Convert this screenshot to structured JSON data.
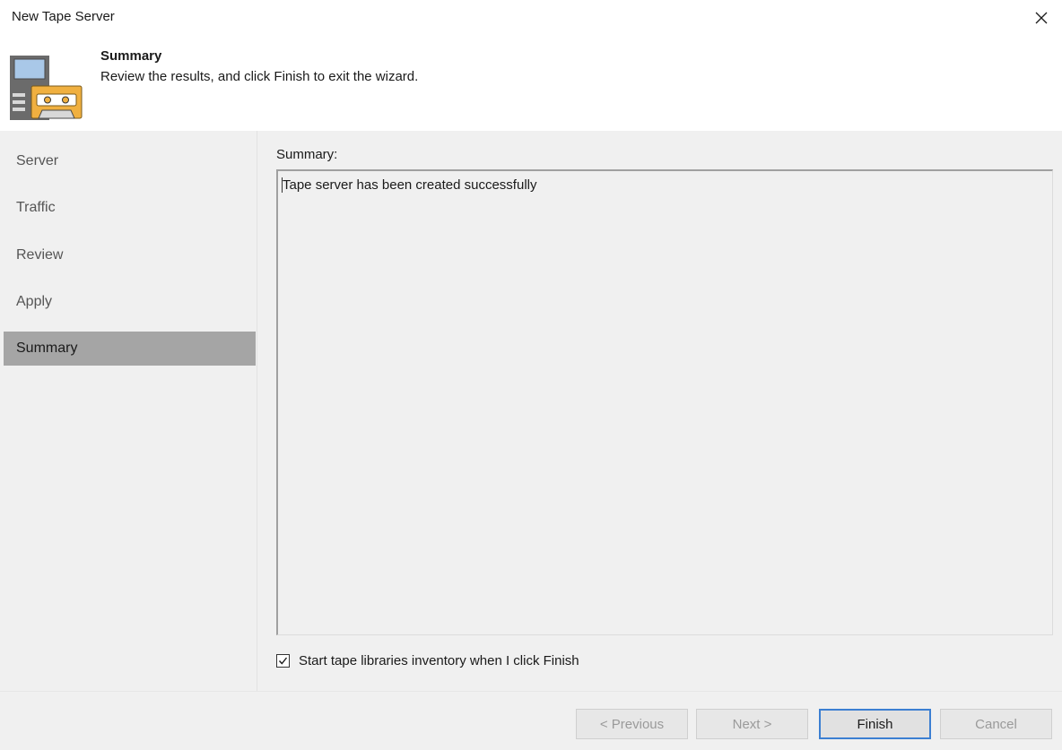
{
  "window": {
    "title": "New Tape Server",
    "close_icon": "close-icon"
  },
  "header": {
    "icon": "tape-server-icon",
    "title": "Summary",
    "subtitle": "Review the results, and click Finish to exit the wizard."
  },
  "sidebar": {
    "items": [
      {
        "label": "Server",
        "active": false
      },
      {
        "label": "Traffic",
        "active": false
      },
      {
        "label": "Review",
        "active": false
      },
      {
        "label": "Apply",
        "active": false
      },
      {
        "label": "Summary",
        "active": true
      }
    ]
  },
  "content": {
    "summary_label": "Summary:",
    "summary_text": "Tape server has been created successfully",
    "checkbox_label": "Start tape libraries inventory when I click Finish",
    "checkbox_checked": true
  },
  "buttons": {
    "previous": "< Previous",
    "next": "Next >",
    "finish": "Finish",
    "cancel": "Cancel"
  },
  "colors": {
    "active_step": "#a5a5a5",
    "panel_bg": "#f0f0f0",
    "primary_border": "#3c7fd2",
    "cassette": "#f0b040",
    "monitor": "#a9c8e8"
  }
}
